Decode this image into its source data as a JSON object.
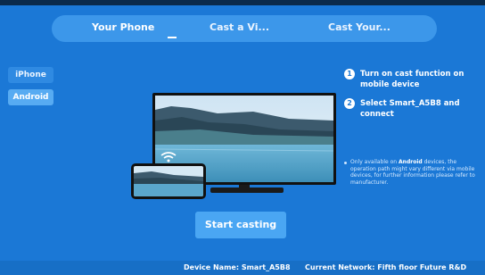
{
  "tabs": [
    {
      "label": "Your Phone",
      "active": true
    },
    {
      "label": "Cast a Vi..."
    },
    {
      "label": "Cast Your..."
    }
  ],
  "sidebar": {
    "items": [
      {
        "label": "iPhone",
        "active": false
      },
      {
        "label": "Android",
        "active": true
      }
    ]
  },
  "steps": [
    {
      "number": "1",
      "text": "Turn on cast function on mobile device"
    },
    {
      "number": "2",
      "text": "Select Smart_A5B8 and connect"
    }
  ],
  "note": {
    "prefix": "Only available on ",
    "highlight": "Android",
    "suffix": " devices, the operation path might vary different via mobile devices, for further information please refer to manufacturer."
  },
  "start_button": {
    "label": "Start casting"
  },
  "footer": {
    "device_name": "Device Name: Smart_A5B8",
    "network": "Current Network: Fifth floor Future R&D"
  },
  "colors": {
    "background": "#1b78d6",
    "tabbar": "#3c97ea",
    "button": "#4aa6f3"
  },
  "icons": [
    "wifi-icon",
    "tv-illustration",
    "phone-illustration"
  ]
}
